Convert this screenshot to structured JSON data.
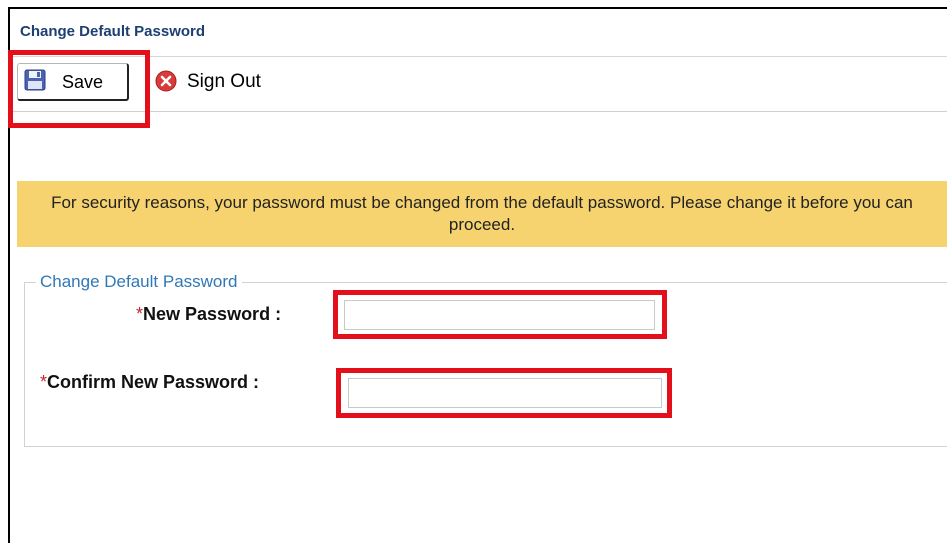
{
  "window": {
    "title": "Change Default Password"
  },
  "toolbar": {
    "save_label": "Save",
    "save_icon": "floppy-disk-icon",
    "signout_label": "Sign Out",
    "signout_icon": "red-x-circle-icon"
  },
  "notice": {
    "text": "For security reasons, your password must be changed from the default password. Please change it before you can proceed.",
    "background": "#f6d36f"
  },
  "form": {
    "legend": "Change Default Password",
    "required_marker": "*",
    "fields": [
      {
        "label": "New Password :",
        "value": "",
        "placeholder": ""
      },
      {
        "label": "Confirm New Password :",
        "value": "",
        "placeholder": ""
      }
    ]
  },
  "colors": {
    "highlight": "#e3101c",
    "title_text": "#1d3f73",
    "legend_text": "#2f78b8",
    "required": "#c0282e"
  }
}
